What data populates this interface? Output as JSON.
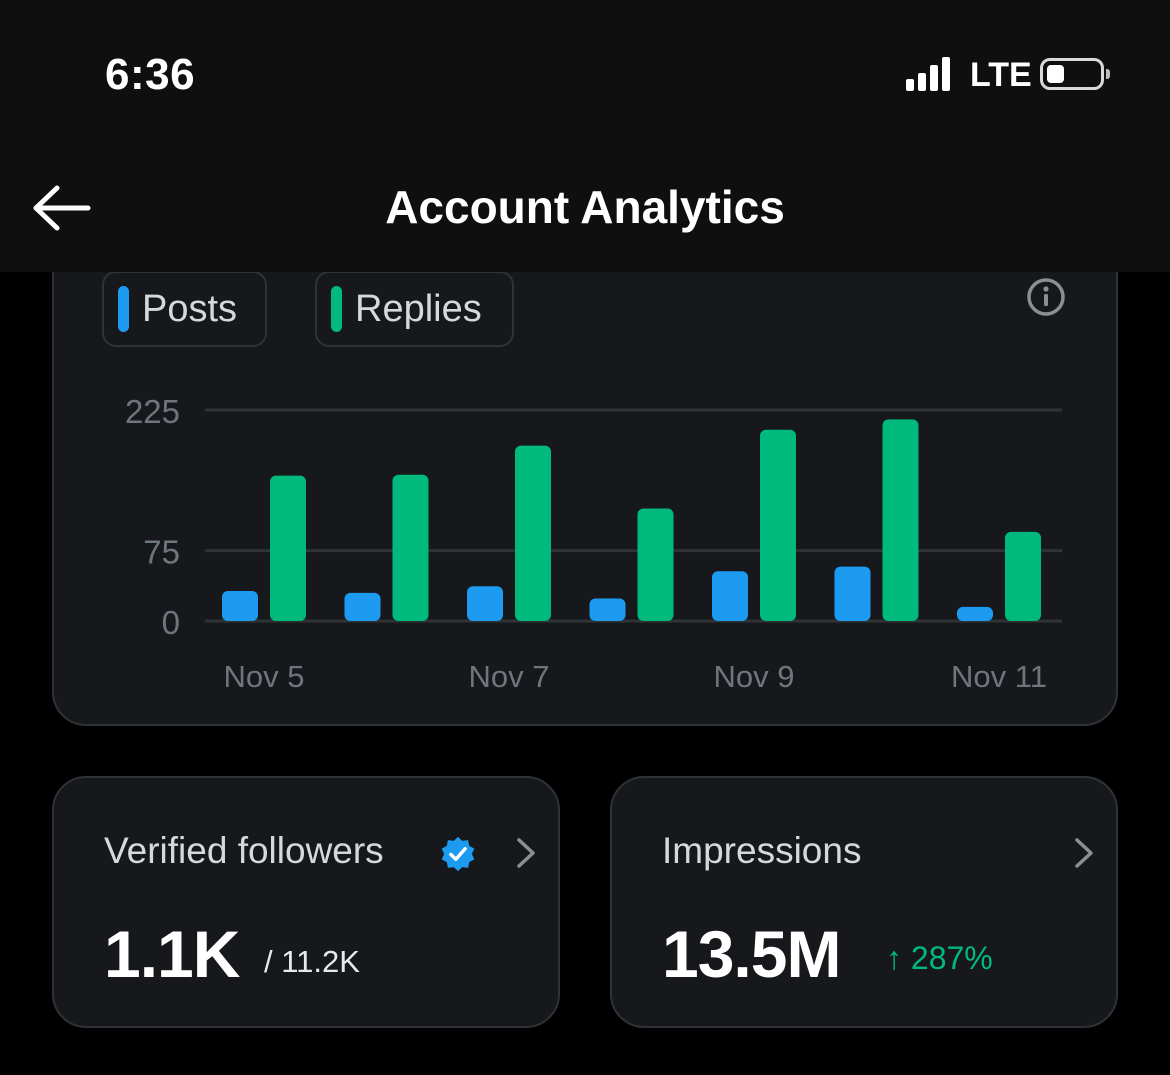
{
  "status_bar": {
    "time": "6:36",
    "network": "LTE",
    "icons": [
      "signal-icon",
      "battery-icon"
    ],
    "battery_level": 0.3
  },
  "header": {
    "title": "Account Analytics",
    "back_icon": "arrow-left-icon"
  },
  "legend": {
    "items": [
      {
        "label": "Posts",
        "color": "#1d9bf0"
      },
      {
        "label": "Replies",
        "color": "#00ba7c"
      }
    ],
    "info_icon": "info-circle-icon"
  },
  "chart_data": {
    "type": "bar",
    "categories": [
      "Nov 5",
      "Nov 6",
      "Nov 7",
      "Nov 8",
      "Nov 9",
      "Nov 10",
      "Nov 11"
    ],
    "x_tick_labels": [
      "Nov 5",
      "",
      "Nov 7",
      "",
      "Nov 9",
      "",
      "Nov 11"
    ],
    "y_ticks": [
      "0",
      "75",
      "225"
    ],
    "ylim": [
      0,
      225
    ],
    "grid": true,
    "series": [
      {
        "name": "Posts",
        "color": "#1d9bf0",
        "values": [
          32,
          30,
          37,
          24,
          53,
          58,
          15
        ]
      },
      {
        "name": "Replies",
        "color": "#00ba7c",
        "values": [
          155,
          156,
          187,
          120,
          204,
          215,
          95
        ]
      }
    ]
  },
  "cards": {
    "verified_followers": {
      "title": "Verified followers",
      "value": "1.1K",
      "total": "/ 11.2K",
      "icon": "verified-badge-icon",
      "badge_color": "#1d9bf0"
    },
    "impressions": {
      "title": "Impressions",
      "value": "13.5M",
      "change": "↑ 287%",
      "change_color": "#00ba7c"
    }
  }
}
